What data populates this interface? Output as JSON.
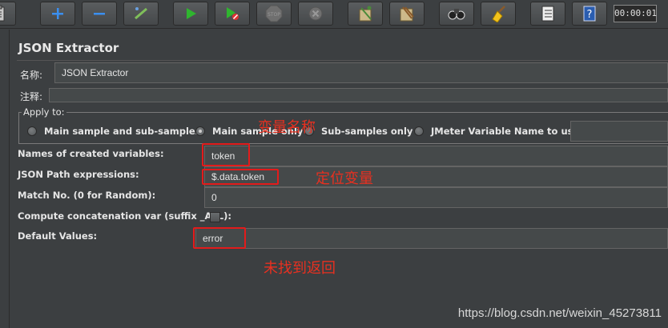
{
  "toolbar": {
    "buttons": [
      {
        "name": "template-icon"
      },
      {
        "name": "add-icon"
      },
      {
        "name": "remove-icon"
      },
      {
        "name": "toggle-icon"
      },
      {
        "name": "start-icon"
      },
      {
        "name": "start-no-pauses-icon"
      },
      {
        "name": "stop-icon"
      },
      {
        "name": "shutdown-icon"
      },
      {
        "name": "clear-icon"
      },
      {
        "name": "clear-all-icon"
      },
      {
        "name": "search-icon"
      },
      {
        "name": "reset-search-icon"
      },
      {
        "name": "function-helper-icon"
      },
      {
        "name": "help-icon"
      }
    ],
    "timer": "00:00:01"
  },
  "panel": {
    "title": "JSON Extractor",
    "name_label": "名称:",
    "name_value": "JSON Extractor",
    "comment_label": "注释:",
    "comment_value": "",
    "apply_to": {
      "legend": "Apply to:",
      "options": [
        {
          "label": "Main sample and sub-samples",
          "checked": false
        },
        {
          "label": "Main sample only",
          "checked": true
        },
        {
          "label": "Sub-samples only",
          "checked": false
        },
        {
          "label": "JMeter Variable Name to use",
          "checked": false
        }
      ],
      "variable_name_value": ""
    },
    "fields": {
      "variables_label": "Names of created variables:",
      "variables_value": "token",
      "jsonpath_label": "JSON Path expressions:",
      "jsonpath_value": "$.data.token",
      "match_label": "Match No. (0 for Random):",
      "match_value": "0",
      "concat_label": "Compute concatenation var (suffix _ALL):",
      "concat_checked": false,
      "default_label": "Default Values:",
      "default_value": "error"
    }
  },
  "annotations": {
    "variable_name_note": "变量名称",
    "locate_variable_note": "定位变量",
    "not_found_note": "未找到返回"
  },
  "watermark": "https://blog.csdn.net/weixin_45273811",
  "colors": {
    "background": "#3c3f41",
    "field": "#45494a",
    "annotation_red": "#e31b1b"
  }
}
